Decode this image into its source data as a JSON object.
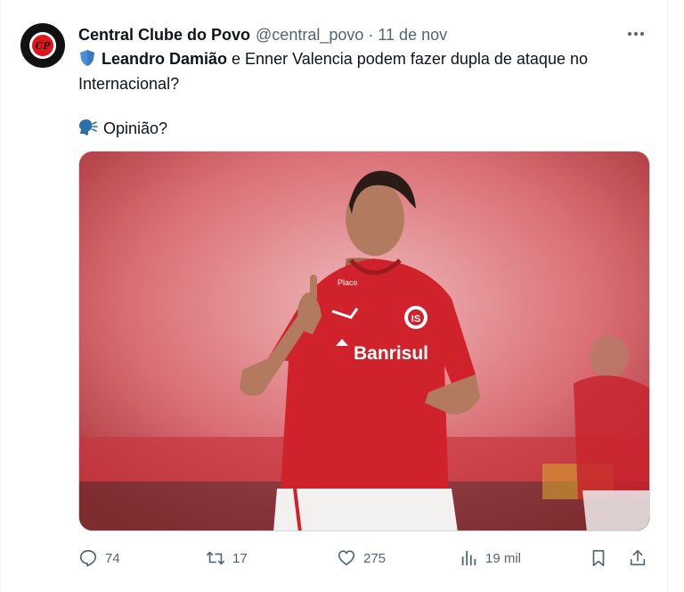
{
  "tweet": {
    "avatar_initials": "CP",
    "author_name": "Central Clube do Povo",
    "handle": "@central_povo",
    "separator": "·",
    "date": "11 de nov",
    "text": {
      "bold_name": "Leandro Damião",
      "line1_rest": " e Enner Valencia podem fazer dupla de ataque no",
      "line2": "Internacional?",
      "line3": "Opinião?"
    },
    "media": {
      "shirt_sponsor": "Banrisul",
      "sleeve_logo": "Place"
    },
    "actions": {
      "replies": "74",
      "retweets": "17",
      "likes": "275",
      "views": "19 mil"
    }
  },
  "colors": {
    "text": "#0f1419",
    "muted": "#536471",
    "shirt_red": "#d0222b",
    "shield_blue": "#4a90d9"
  },
  "icons": [
    "more-icon",
    "shield-emoji-icon",
    "speaking-head-icon",
    "reply-icon",
    "retweet-icon",
    "like-icon",
    "views-icon",
    "bookmark-icon",
    "share-icon"
  ]
}
